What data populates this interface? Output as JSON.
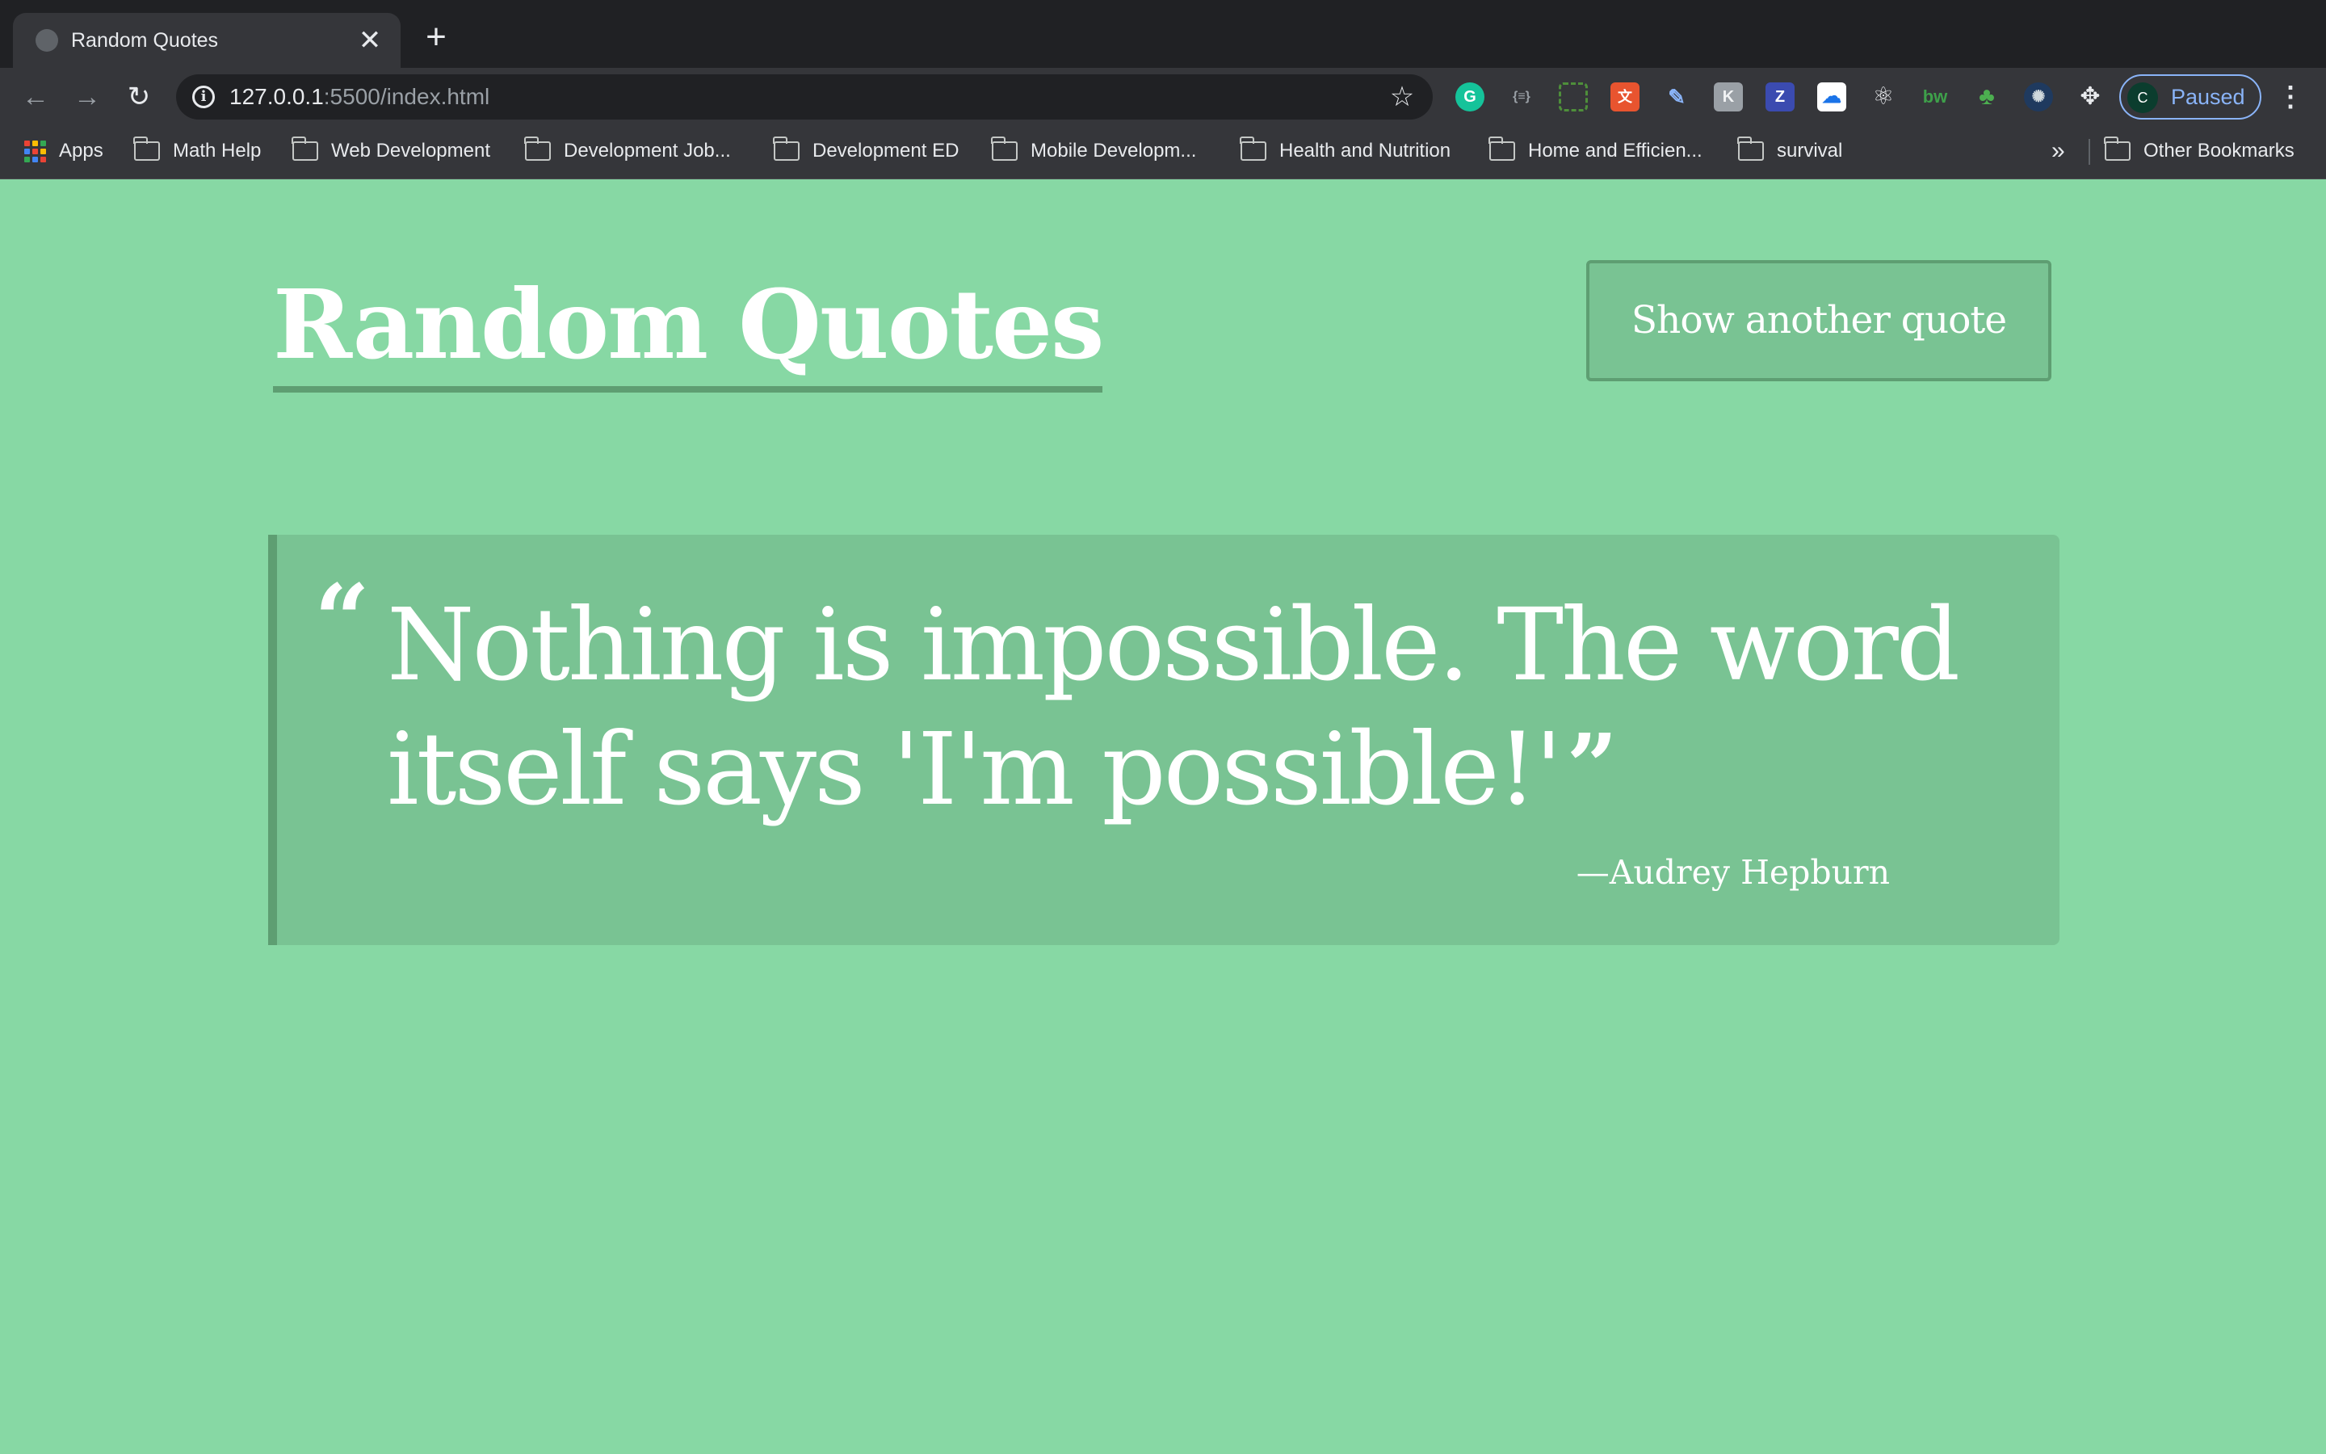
{
  "browser": {
    "tab_title": "Random Quotes",
    "tab_close": "✕",
    "new_tab": "+",
    "url_host": "127.0.0.1",
    "url_path": ":5500/index.html",
    "profile_initial": "C",
    "profile_label": "Paused",
    "bookmarks": {
      "apps": "Apps",
      "items": [
        "Math Help",
        "Web Development",
        "Development Job...",
        "Development ED",
        "Mobile Developm...",
        "Health and Nutrition",
        "Home and Efficien...",
        "survival"
      ],
      "more": "»",
      "other": "Other Bookmarks"
    },
    "extensions": [
      "grammarly-icon",
      "brackets-icon",
      "screenshot-icon",
      "translate-icon",
      "pen-icon",
      "k-icon",
      "z-icon",
      "cloud-icon",
      "react-icon",
      "bw-icon",
      "tree-icon",
      "aperture-icon",
      "puzzle-icon"
    ]
  },
  "page": {
    "heading": "Random Quotes",
    "button_label": "Show another quote",
    "quote": {
      "open_mark": "“",
      "text": "Nothing is impossible. The word itself says 'I'm possible!'",
      "close_mark": "”",
      "author": "—Audrey Hepburn"
    }
  },
  "colors": {
    "background": "#87d8a4",
    "panel": "#79c393",
    "accent_border": "#5e9e72",
    "text": "#ffffff"
  }
}
